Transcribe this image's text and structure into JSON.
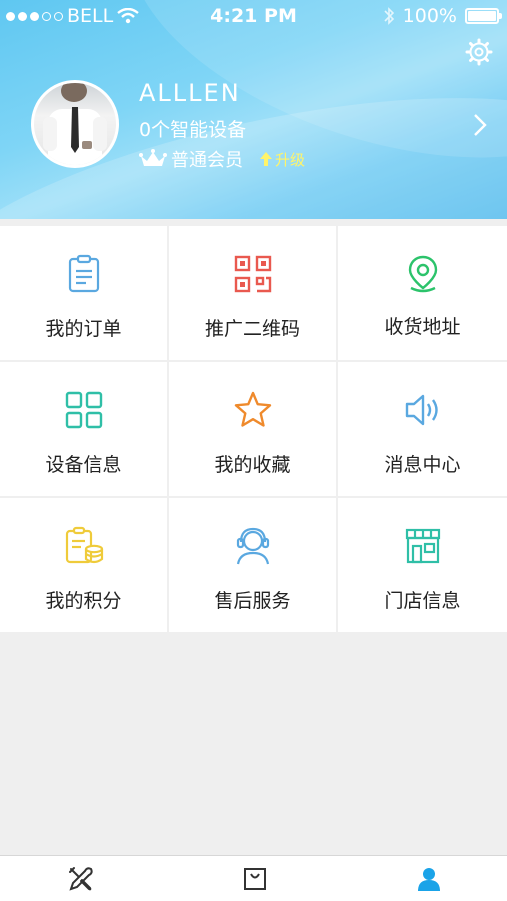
{
  "status_bar": {
    "carrier": "BELL",
    "time": "4:21 PM",
    "battery": "100%",
    "battery_level": 1.0
  },
  "profile": {
    "username": "ALLLEN",
    "devices": "0个智能设备",
    "membership": "普通会员",
    "upgrade": "升级"
  },
  "menu": [
    [
      {
        "label": "我的订单",
        "icon": "clipboard-icon",
        "color": "#5aa8e0"
      },
      {
        "label": "推广二维码",
        "icon": "qrcode-icon",
        "color": "#e9594f"
      },
      {
        "label": "收货地址",
        "icon": "location-pin-icon",
        "color": "#2cc36b"
      }
    ],
    [
      {
        "label": "设备信息",
        "icon": "grid-icon",
        "color": "#2fbfa7"
      },
      {
        "label": "我的收藏",
        "icon": "star-icon",
        "color": "#ef8a2c"
      },
      {
        "label": "消息中心",
        "icon": "speaker-icon",
        "color": "#5aa8e0"
      }
    ],
    [
      {
        "label": "我的积分",
        "icon": "coins-icon",
        "color": "#efcb3a"
      },
      {
        "label": "售后服务",
        "icon": "headset-agent-icon",
        "color": "#5aa8e0"
      },
      {
        "label": "门店信息",
        "icon": "store-icon",
        "color": "#2fbfa7"
      }
    ]
  ],
  "tabbar": [
    {
      "icon": "tools-icon",
      "active": false
    },
    {
      "icon": "shopping-bag-icon",
      "active": false
    },
    {
      "icon": "user-icon",
      "active": true
    }
  ],
  "colors": {
    "accent": "#1aa3e8",
    "header_gradient": "#5fc7f1",
    "upgrade": "#fff46a"
  }
}
